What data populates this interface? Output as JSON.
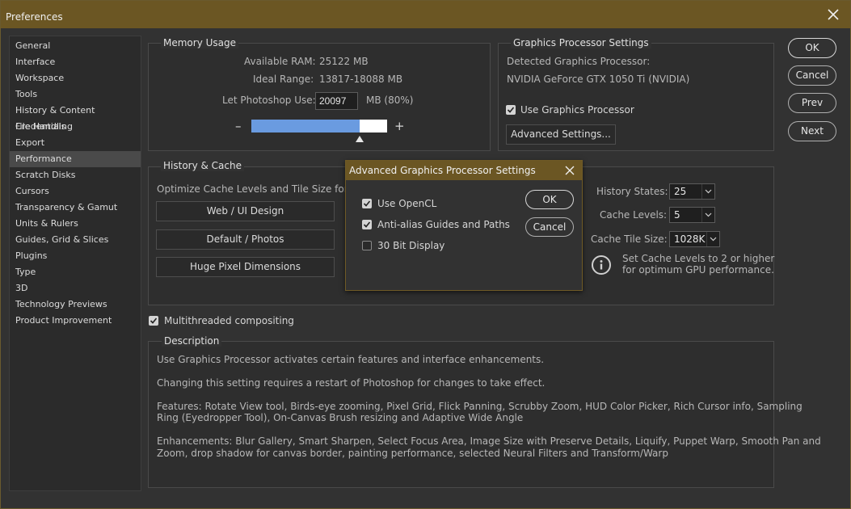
{
  "window": {
    "title": "Preferences"
  },
  "sidebar": {
    "items": [
      {
        "label": "General"
      },
      {
        "label": "Interface"
      },
      {
        "label": "Workspace"
      },
      {
        "label": "Tools"
      },
      {
        "label": "History & Content Credentials"
      },
      {
        "label": "File Handling"
      },
      {
        "label": "Export"
      },
      {
        "label": "Performance",
        "selected": true
      },
      {
        "label": "Scratch Disks"
      },
      {
        "label": "Cursors"
      },
      {
        "label": "Transparency & Gamut"
      },
      {
        "label": "Units & Rulers"
      },
      {
        "label": "Guides, Grid & Slices"
      },
      {
        "label": "Plugins"
      },
      {
        "label": "Type"
      },
      {
        "label": "3D"
      },
      {
        "label": "Technology Previews"
      },
      {
        "label": "Product Improvement"
      }
    ]
  },
  "memory": {
    "title": "Memory Usage",
    "available_label": "Available RAM:",
    "available_value": "25122 MB",
    "ideal_label": "Ideal Range:",
    "ideal_value": "13817-18088 MB",
    "let_label": "Let Photoshop Use:",
    "let_value": "20097",
    "let_suffix": "MB (80%)",
    "minus": "–",
    "plus": "+",
    "usage_fraction": 0.8
  },
  "gpu": {
    "title": "Graphics Processor Settings",
    "detected_label": "Detected Graphics Processor:",
    "detected_value": "NVIDIA GeForce GTX 1050 Ti (NVIDIA)",
    "use_gpu_label": "Use Graphics Processor",
    "use_gpu_checked": true,
    "advanced_button": "Advanced Settings..."
  },
  "history": {
    "title": "History & Cache",
    "optimize_label": "Optimize Cache Levels and Tile Size for:",
    "buttons": [
      "Web / UI Design",
      "Default / Photos",
      "Huge Pixel Dimensions"
    ],
    "states_label": "History States:",
    "states_value": "25",
    "levels_label": "Cache Levels:",
    "levels_value": "5",
    "tile_label": "Cache Tile Size:",
    "tile_value": "1028K",
    "info_line1": "Set Cache Levels to 2 or higher",
    "info_line2": "for optimum GPU performance."
  },
  "multithread": {
    "label": "Multithreaded compositing",
    "checked": true
  },
  "description": {
    "title": "Description",
    "p1": "Use Graphics Processor activates certain features and interface enhancements.",
    "p2": "Changing this setting requires a restart of Photoshop for changes to take effect.",
    "p3a": "Features: Rotate View tool, Birds-eye zooming, Pixel Grid, Flick Panning, Scrubby Zoom, HUD Color Picker, Rich Cursor info, Sampling",
    "p3b": "Ring (Eyedropper Tool), On-Canvas Brush resizing and Adaptive Wide Angle",
    "p4a": "Enhancements: Blur Gallery, Smart Sharpen, Select Focus Area, Image Size with Preserve Details, Liquify, Puppet Warp, Smooth Pan and",
    "p4b": "Zoom, drop shadow for canvas border, painting performance, selected Neural Filters and Transform/Warp"
  },
  "actions": {
    "ok": "OK",
    "cancel": "Cancel",
    "prev": "Prev",
    "next": "Next"
  },
  "dialog": {
    "title": "Advanced Graphics Processor Settings",
    "opencl_label": "Use OpenCL",
    "opencl_checked": true,
    "antialias_label": "Anti-alias Guides and Paths",
    "antialias_checked": true,
    "bit30_label": "30 Bit Display",
    "bit30_checked": false,
    "ok": "OK",
    "cancel": "Cancel"
  },
  "colors": {
    "titlebar": "#6b5623",
    "slider_fill": "#6a9be0",
    "panel": "#323232"
  },
  "icons": {
    "close": "close-icon",
    "check": "checkmark-icon",
    "dropdown": "chevron-down-icon",
    "info": "info-icon"
  }
}
